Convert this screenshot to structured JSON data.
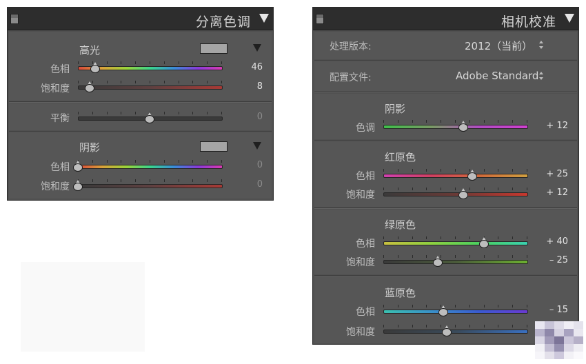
{
  "split_toning": {
    "title": "分离色调",
    "highlights": {
      "label": "高光",
      "hue_label": "色相",
      "hue_value": "46",
      "hue_pos": 0.12,
      "sat_label": "饱和度",
      "sat_value": "8",
      "sat_pos": 0.08
    },
    "balance": {
      "label": "平衡",
      "value": "0",
      "pos": 0.5
    },
    "shadows": {
      "label": "阴影",
      "hue_label": "色相",
      "hue_value": "0",
      "hue_pos": 0.0,
      "sat_label": "饱和度",
      "sat_value": "0",
      "sat_pos": 0.0
    }
  },
  "camera_calibration": {
    "title": "相机校准",
    "process_label": "处理版本:",
    "process_value": "2012（当前）",
    "profile_label": "配置文件:",
    "profile_value": "Adobe Standard",
    "shadows": {
      "label": "阴影",
      "tint_label": "色调",
      "tint_value": "+ 12",
      "tint_pos": 0.56
    },
    "red_primary": {
      "label": "红原色",
      "hue_label": "色相",
      "hue_value": "+ 25",
      "hue_pos": 0.62,
      "sat_label": "饱和度",
      "sat_value": "+ 12",
      "sat_pos": 0.56
    },
    "green_primary": {
      "label": "绿原色",
      "hue_label": "色相",
      "hue_value": "+ 40",
      "hue_pos": 0.7,
      "sat_label": "饱和度",
      "sat_value": "– 25",
      "sat_pos": 0.38
    },
    "blue_primary": {
      "label": "蓝原色",
      "hue_label": "色相",
      "hue_value": "– 15",
      "hue_pos": 0.42,
      "sat_label": "饱和度",
      "sat_value": "",
      "sat_pos": 0.44
    }
  },
  "colors": {
    "panel_bg": "#505050",
    "header_bg": "#2d2d2d",
    "swatch_gray": "#a5a5a5"
  }
}
